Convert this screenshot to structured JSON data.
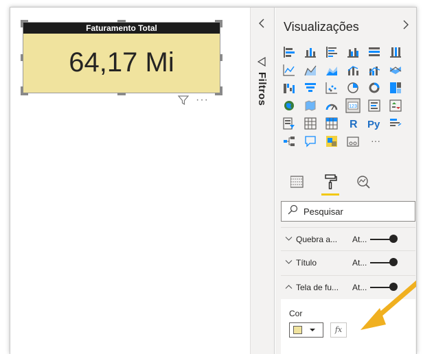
{
  "card": {
    "title": "Faturamento Total",
    "value": "64,17 Mi",
    "background": "#f0e39e",
    "more": "···"
  },
  "filters_pane": {
    "label": "Filtros",
    "collapse_icon": "chevron-left-icon"
  },
  "visualizations": {
    "title": "Visualizações",
    "expand_icon": "chevron-right-icon",
    "more": "···",
    "icons": [
      "stacked-bar-icon",
      "stacked-column-icon",
      "clustered-bar-icon",
      "clustered-column-icon",
      "100-bar-icon",
      "100-column-icon",
      "line-chart-icon",
      "area-chart-icon",
      "stacked-area-icon",
      "line-column-icon",
      "line-clustered-icon",
      "ribbon-chart-icon",
      "waterfall-icon",
      "funnel-icon",
      "scatter-icon",
      "pie-icon",
      "donut-icon",
      "treemap-icon",
      "map-icon",
      "filled-map-icon",
      "gauge-icon",
      "card-icon",
      "multirow-card-icon",
      "kpi-icon",
      "slicer-icon",
      "table-icon",
      "matrix-icon",
      "r-visual-icon",
      "python-visual-icon",
      "key-influencers-icon",
      "decomposition-tree-icon",
      "qa-icon",
      "smart-narrative-icon",
      "paginated-icon",
      "more-visuals-icon"
    ],
    "r_label": "R",
    "py_label": "Py"
  },
  "format_tabs": [
    "fields-tab",
    "format-tab",
    "analytics-tab"
  ],
  "search": {
    "placeholder": "Pesquisar"
  },
  "sections": [
    {
      "label": "Quebra a...",
      "state": "At...",
      "expanded": false
    },
    {
      "label": "Título",
      "state": "At...",
      "expanded": false
    },
    {
      "label": "Tela de fu...",
      "state": "At...",
      "expanded": true
    }
  ],
  "color": {
    "label": "Cor",
    "value": "#f0e39e",
    "fx_label": "fx"
  },
  "colors": {
    "accent": "#f2c811",
    "annotation_arrow": "#f0b020"
  }
}
